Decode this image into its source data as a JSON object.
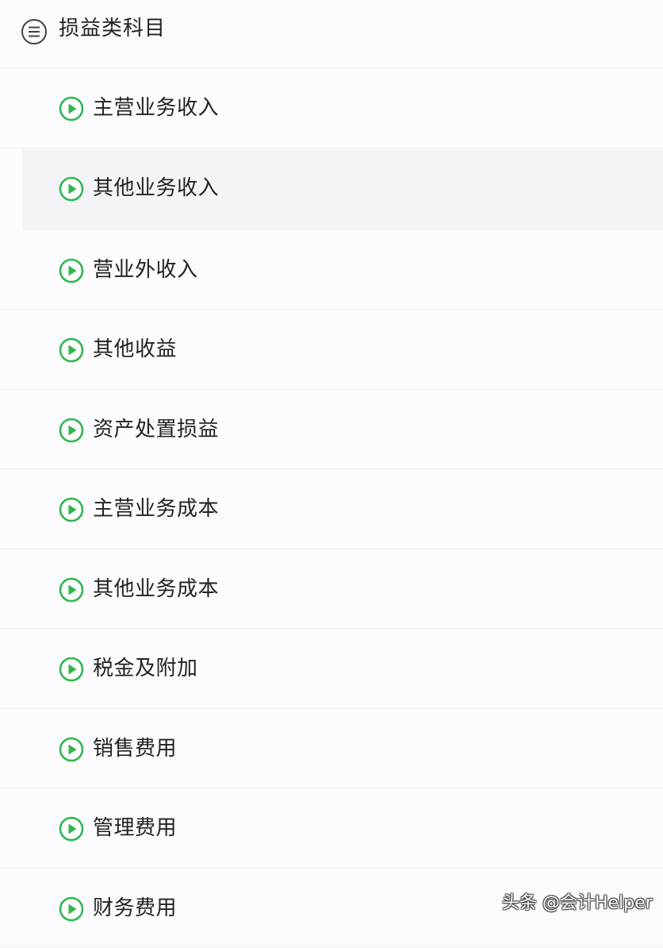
{
  "header": {
    "title": "损益类科目",
    "icon": "menu-list-icon"
  },
  "items": [
    {
      "label": "主营业务收入",
      "icon": "play-circle-icon"
    },
    {
      "label": "其他业务收入",
      "icon": "play-circle-icon",
      "active": true
    },
    {
      "label": "营业外收入",
      "icon": "play-circle-icon"
    },
    {
      "label": "其他收益",
      "icon": "play-circle-icon"
    },
    {
      "label": "资产处置损益",
      "icon": "play-circle-icon"
    },
    {
      "label": "主营业务成本",
      "icon": "play-circle-icon"
    },
    {
      "label": "其他业务成本",
      "icon": "play-circle-icon"
    },
    {
      "label": "税金及附加",
      "icon": "play-circle-icon"
    },
    {
      "label": "销售费用",
      "icon": "play-circle-icon"
    },
    {
      "label": "管理费用",
      "icon": "play-circle-icon"
    },
    {
      "label": "财务费用",
      "icon": "play-circle-icon"
    }
  ],
  "watermark": "头条 @会计Helper",
  "colors": {
    "accent": "#2db84d",
    "background": "#fcfbfd",
    "active_row": "#f4f3f6",
    "divider": "#efeef2"
  }
}
